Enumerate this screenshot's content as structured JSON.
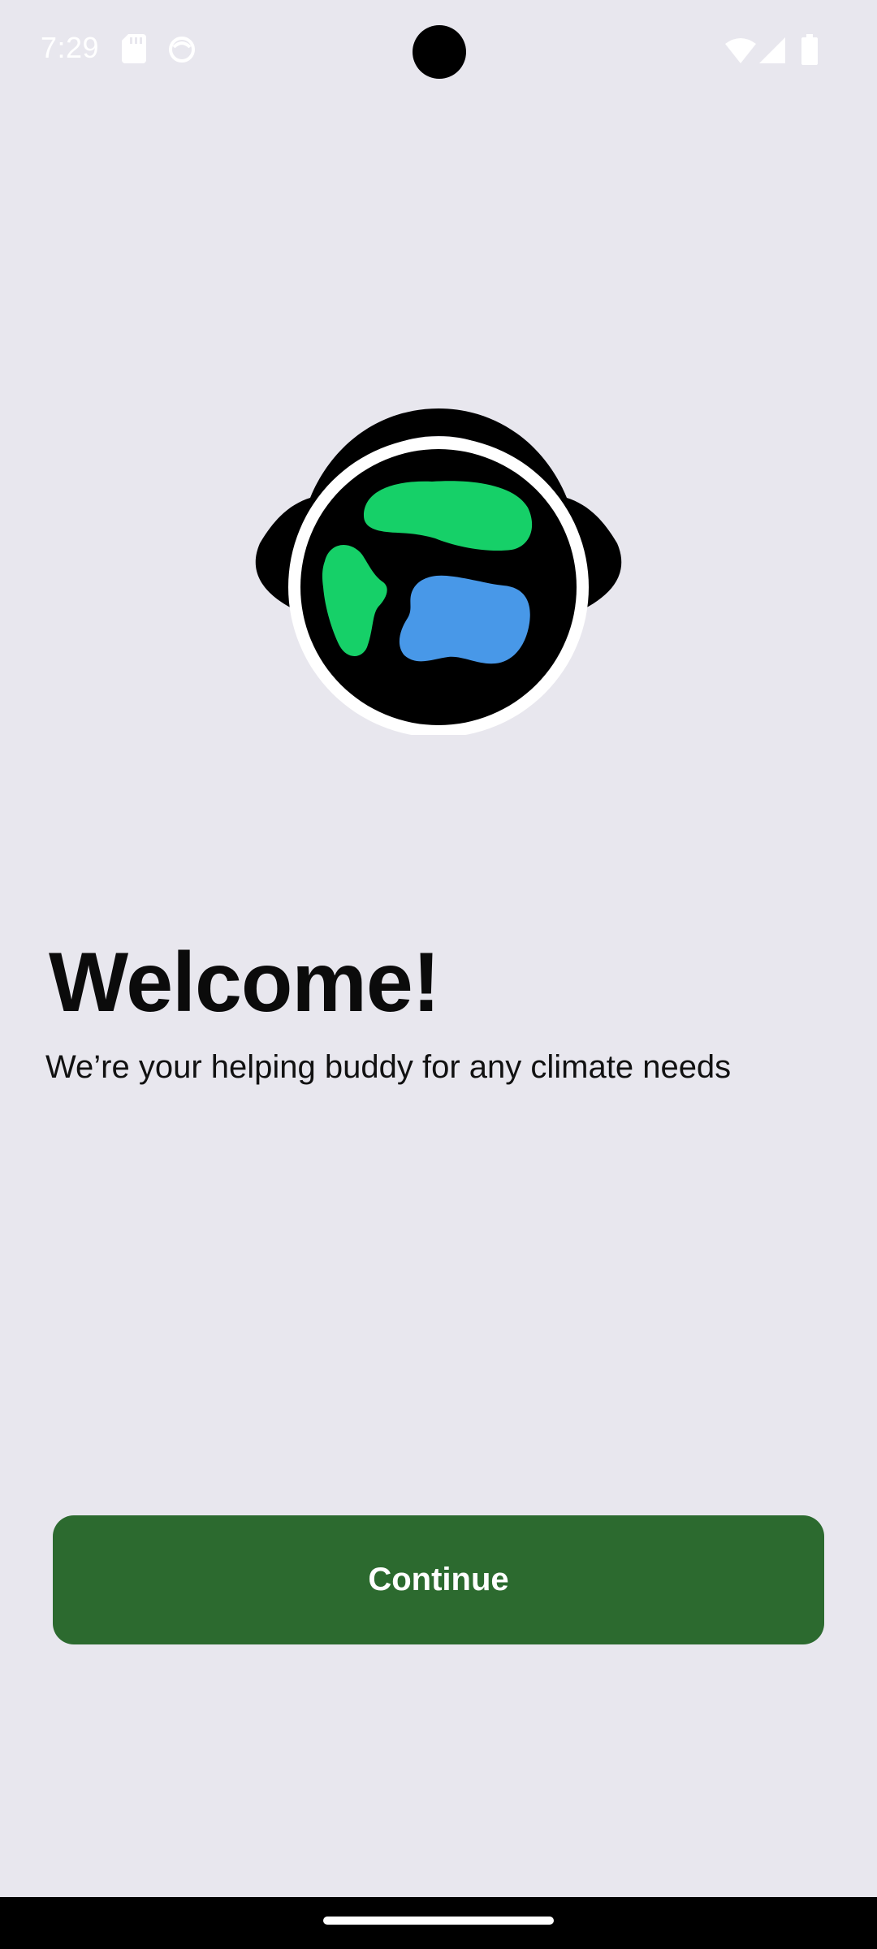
{
  "status_bar": {
    "time": "7:29",
    "left_icons": [
      "sd-card-icon",
      "notification-app-icon"
    ],
    "right_icons": [
      "wifi-icon",
      "cellular-signal-icon",
      "battery-icon"
    ]
  },
  "logo": {
    "icon": "globe-with-headphones-logo",
    "colors": {
      "outline": "#000000",
      "land": "#16d068",
      "water": "#4898e8"
    }
  },
  "welcome": {
    "title": "Welcome!",
    "subtitle": "We’re your helping buddy for any climate needs"
  },
  "continue_button": {
    "label": "Continue",
    "color": "#2c6a2f"
  },
  "colors": {
    "background": "#e8e7ee",
    "nav_bar": "#000000"
  }
}
